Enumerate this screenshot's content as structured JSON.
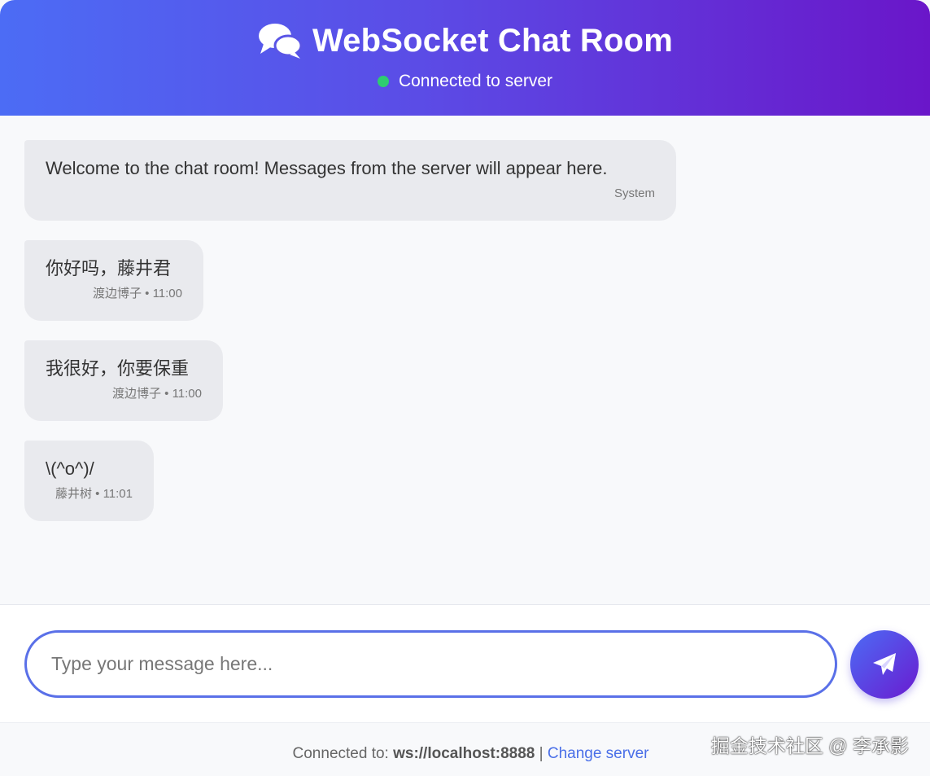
{
  "header": {
    "icon": "comments-icon",
    "title": "WebSocket Chat Room",
    "status_text": "Connected to server",
    "status_color": "#2ecc71"
  },
  "messages": [
    {
      "text": "Welcome to the chat room! Messages from the server will appear here.",
      "meta": "System"
    },
    {
      "text": "你好吗，藤井君",
      "meta": "渡边博子 • 11:00"
    },
    {
      "text": "我很好，你要保重",
      "meta": "渡边博子 • 11:00"
    },
    {
      "text": "\\(^o^)/",
      "meta": "藤井树 • 11:01"
    }
  ],
  "composer": {
    "placeholder": "Type your message here...",
    "value": "",
    "send_icon": "paper-plane-icon"
  },
  "footer": {
    "connected_label": "Connected to:",
    "server_url": "ws://localhost:8888",
    "separator": "|",
    "change_link": "Change server"
  },
  "watermark": "掘金技术社区 @ 李承影",
  "colors": {
    "accent_start": "#4c6cf5",
    "accent_end": "#6a16c9",
    "bubble": "#e9eaee",
    "link": "#4a6fe8"
  }
}
